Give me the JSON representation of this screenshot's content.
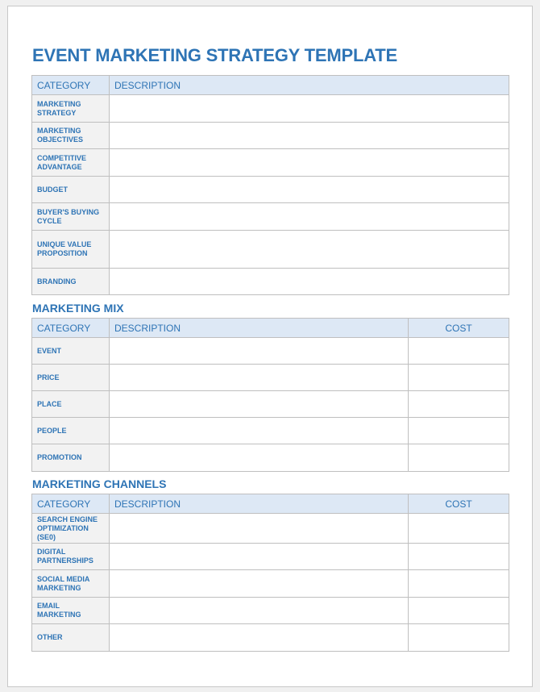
{
  "title": "EVENT MARKETING STRATEGY TEMPLATE",
  "colors": {
    "accent": "#2e74b5",
    "header_fill": "#dde8f5",
    "category_fill": "#f2f2f2",
    "border": "#bfbfbf"
  },
  "strategy_table": {
    "headers": {
      "category": "CATEGORY",
      "description": "DESCRIPTION"
    },
    "rows": [
      {
        "category": "MARKETING\nSTRATEGY",
        "description": ""
      },
      {
        "category": "MARKETING\nOBJECTIVES",
        "description": ""
      },
      {
        "category": "COMPETITIVE\nADVANTAGE",
        "description": ""
      },
      {
        "category": "BUDGET",
        "description": ""
      },
      {
        "category": "BUYER'S BUYING\nCYCLE",
        "description": ""
      },
      {
        "category": "UNIQUE VALUE\nPROPOSITION",
        "description": ""
      },
      {
        "category": "BRANDING",
        "description": ""
      }
    ]
  },
  "marketing_mix": {
    "title": "MARKETING MIX",
    "headers": {
      "category": "CATEGORY",
      "description": "DESCRIPTION",
      "cost": "COST"
    },
    "rows": [
      {
        "category": "EVENT",
        "description": "",
        "cost": ""
      },
      {
        "category": "PRICE",
        "description": "",
        "cost": ""
      },
      {
        "category": "PLACE",
        "description": "",
        "cost": ""
      },
      {
        "category": "PEOPLE",
        "description": "",
        "cost": ""
      },
      {
        "category": "PROMOTION",
        "description": "",
        "cost": ""
      }
    ]
  },
  "marketing_channels": {
    "title": "MARKETING CHANNELS",
    "headers": {
      "category": "CATEGORY",
      "description": "DESCRIPTION",
      "cost": "COST"
    },
    "rows": [
      {
        "category": "SEARCH ENGINE\nOPTIMIZATION\n(SE0)",
        "description": "",
        "cost": ""
      },
      {
        "category": "DIGITAL\nPARTNERSHIPS",
        "description": "",
        "cost": ""
      },
      {
        "category": "SOCIAL MEDIA\nMARKETING",
        "description": "",
        "cost": ""
      },
      {
        "category": "EMAIL\nMARKETING",
        "description": "",
        "cost": ""
      },
      {
        "category": "OTHER",
        "description": "",
        "cost": ""
      }
    ]
  }
}
